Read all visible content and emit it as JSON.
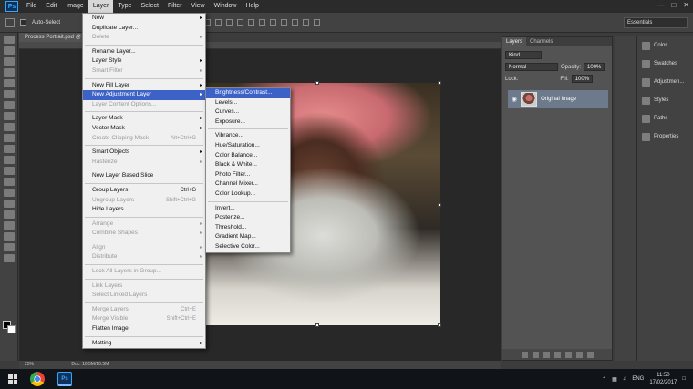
{
  "menubar": {
    "logo": "Ps",
    "items": [
      "File",
      "Edit",
      "Image",
      "Layer",
      "Type",
      "Select",
      "Filter",
      "View",
      "Window",
      "Help"
    ],
    "active": "Layer"
  },
  "options": {
    "auto_select": "Auto-Select",
    "workspace": "Essentials"
  },
  "document": {
    "tab": "Process Portrait.psd @",
    "zoom": "25%",
    "doc_size": "Doc: 10.5M/10.5M"
  },
  "layer_menu": [
    {
      "label": "New",
      "arrow": true
    },
    {
      "label": "Duplicate Layer..."
    },
    {
      "label": "Delete",
      "arrow": true,
      "disabled": true
    },
    {
      "sep": true
    },
    {
      "label": "Rename Layer..."
    },
    {
      "label": "Layer Style",
      "arrow": true
    },
    {
      "label": "Smart Filter",
      "arrow": true,
      "disabled": true
    },
    {
      "sep": true
    },
    {
      "label": "New Fill Layer",
      "arrow": true
    },
    {
      "label": "New Adjustment Layer",
      "arrow": true,
      "highlight": true
    },
    {
      "label": "Layer Content Options...",
      "disabled": true
    },
    {
      "sep": true
    },
    {
      "label": "Layer Mask",
      "arrow": true
    },
    {
      "label": "Vector Mask",
      "arrow": true
    },
    {
      "label": "Create Clipping Mask",
      "shortcut": "Alt+Ctrl+G",
      "disabled": true
    },
    {
      "sep": true
    },
    {
      "label": "Smart Objects",
      "arrow": true
    },
    {
      "label": "Rasterize",
      "arrow": true,
      "disabled": true
    },
    {
      "sep": true
    },
    {
      "label": "New Layer Based Slice"
    },
    {
      "sep": true
    },
    {
      "label": "Group Layers",
      "shortcut": "Ctrl+G"
    },
    {
      "label": "Ungroup Layers",
      "shortcut": "Shift+Ctrl+G",
      "disabled": true
    },
    {
      "label": "Hide Layers"
    },
    {
      "sep": true
    },
    {
      "label": "Arrange",
      "arrow": true,
      "disabled": true
    },
    {
      "label": "Combine Shapes",
      "arrow": true,
      "disabled": true
    },
    {
      "sep": true
    },
    {
      "label": "Align",
      "arrow": true,
      "disabled": true
    },
    {
      "label": "Distribute",
      "arrow": true,
      "disabled": true
    },
    {
      "sep": true
    },
    {
      "label": "Lock All Layers in Group...",
      "disabled": true
    },
    {
      "sep": true
    },
    {
      "label": "Link Layers",
      "disabled": true
    },
    {
      "label": "Select Linked Layers",
      "disabled": true
    },
    {
      "sep": true
    },
    {
      "label": "Merge Layers",
      "shortcut": "Ctrl+E",
      "disabled": true
    },
    {
      "label": "Merge Visible",
      "shortcut": "Shift+Ctrl+E",
      "disabled": true
    },
    {
      "label": "Flatten Image"
    },
    {
      "sep": true
    },
    {
      "label": "Matting",
      "arrow": true
    }
  ],
  "adjustment_menu": [
    {
      "label": "Brightness/Contrast...",
      "highlight": true
    },
    {
      "label": "Levels..."
    },
    {
      "label": "Curves..."
    },
    {
      "label": "Exposure..."
    },
    {
      "sep": true
    },
    {
      "label": "Vibrance..."
    },
    {
      "label": "Hue/Saturation..."
    },
    {
      "label": "Color Balance..."
    },
    {
      "label": "Black & White..."
    },
    {
      "label": "Photo Filter..."
    },
    {
      "label": "Channel Mixer..."
    },
    {
      "label": "Color Lookup..."
    },
    {
      "sep": true
    },
    {
      "label": "Invert..."
    },
    {
      "label": "Posterize..."
    },
    {
      "label": "Threshold..."
    },
    {
      "label": "Gradient Map..."
    },
    {
      "label": "Selective Color..."
    }
  ],
  "layers_panel": {
    "tabs": [
      "Layers",
      "Channels"
    ],
    "kind": "Kind",
    "blend_mode": "Normal",
    "opacity_label": "Opacity:",
    "opacity": "100%",
    "lock_label": "Lock:",
    "fill_label": "Fill:",
    "fill": "100%",
    "layer_name": "Original Image"
  },
  "right_dock": [
    "Color",
    "Swatches",
    "Adjustmen...",
    "Styles",
    "Paths",
    "Properties"
  ],
  "taskbar": {
    "ps": "Ps",
    "lang": "ENG",
    "time": "11:50",
    "date": "17/02/2017"
  },
  "colors": {
    "menu_highlight": "#3c62c8",
    "ps_blue": "#31a8ff"
  }
}
